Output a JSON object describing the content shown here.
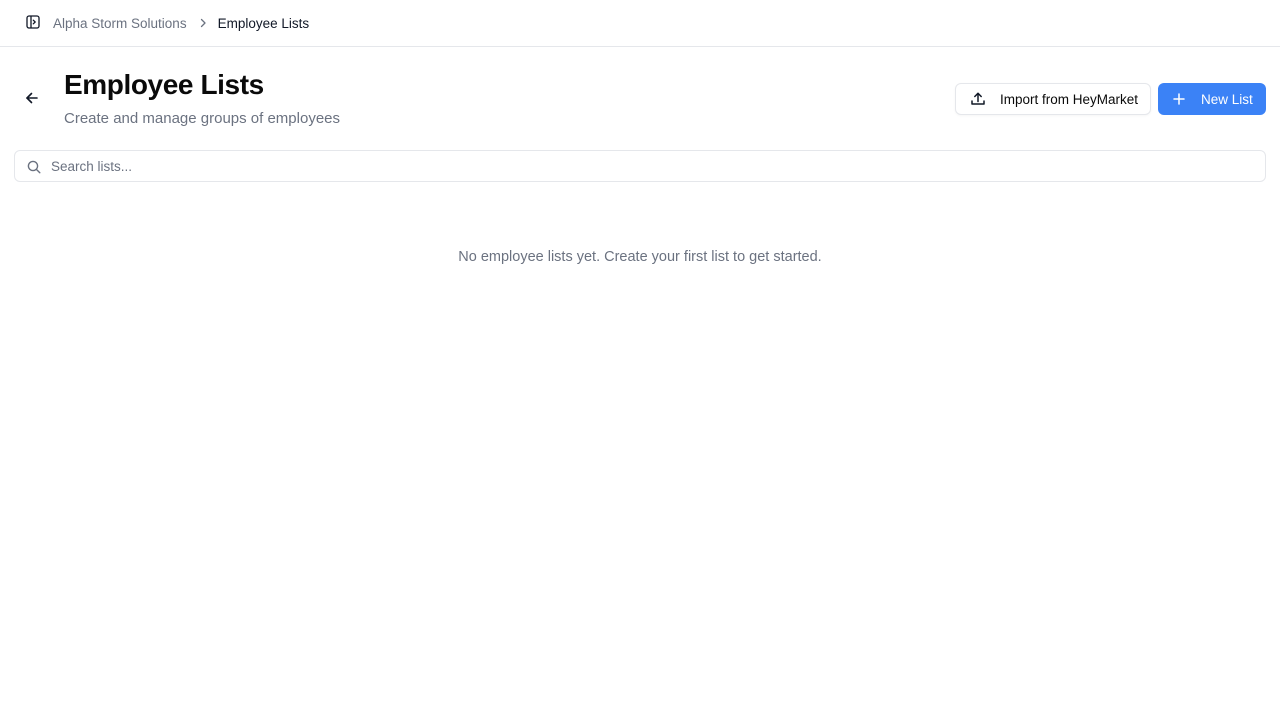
{
  "breadcrumb": {
    "org": "Alpha Storm Solutions",
    "current": "Employee Lists"
  },
  "header": {
    "title": "Employee Lists",
    "subtitle": "Create and manage groups of employees"
  },
  "actions": {
    "import_label": "Import from HeyMarket",
    "new_list_label": "New List"
  },
  "search": {
    "placeholder": "Search lists...",
    "value": ""
  },
  "empty_state": {
    "message": "No employee lists yet. Create your first list to get started."
  },
  "icons": {
    "sidebar_toggle": "panel-left-icon",
    "chevron": "chevron-right-icon",
    "back": "arrow-left-icon",
    "import": "upload-icon",
    "new": "plus-icon",
    "search": "search-icon"
  },
  "colors": {
    "accent": "#3b82f6",
    "muted_text": "#6b7280",
    "border": "#e5e7eb"
  }
}
